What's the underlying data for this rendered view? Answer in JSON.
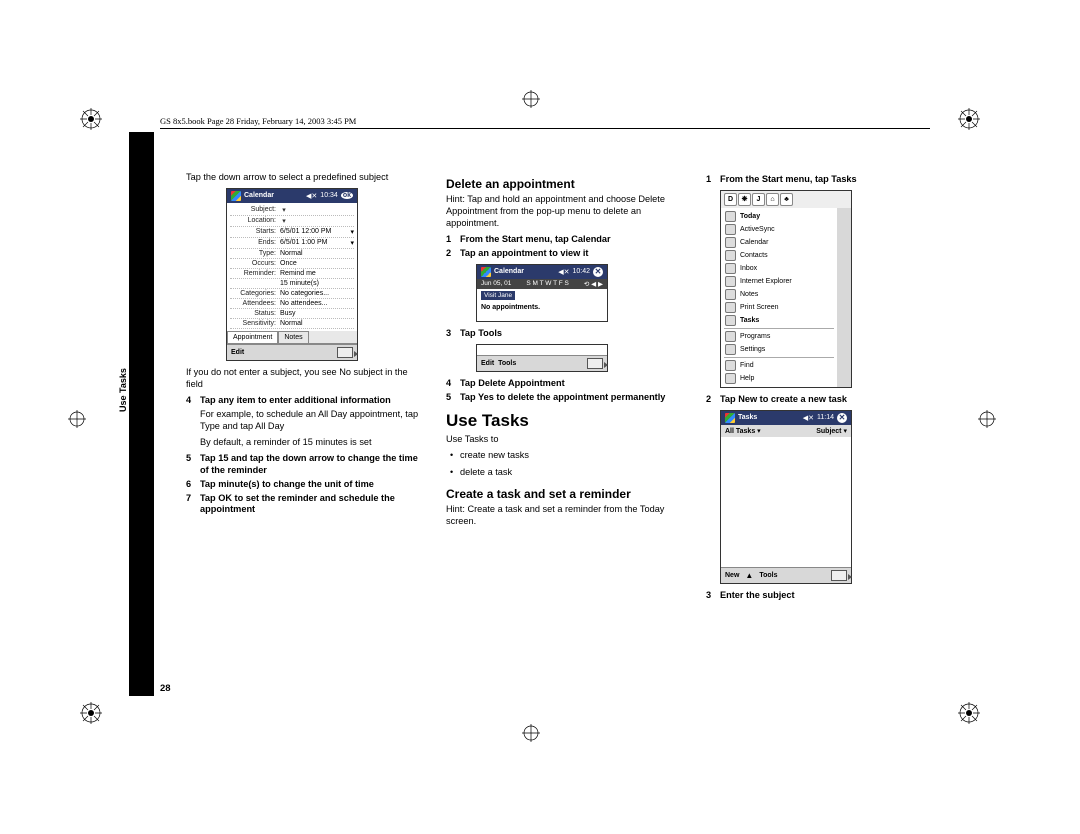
{
  "header": "GS 8x5.book  Page 28  Friday, February 14, 2003  3:45 PM",
  "side_tab": "Use Tasks",
  "page_number": "28",
  "col1": {
    "intro": "Tap the down arrow to select a predefined subject",
    "device": {
      "title": "Calendar",
      "time": "10:34",
      "rows": {
        "subject": {
          "label": "Subject:",
          "value": ""
        },
        "location": {
          "label": "Location:",
          "value": ""
        },
        "starts": {
          "label": "Starts:",
          "value": "6/5/01      12:00 PM"
        },
        "ends": {
          "label": "Ends:",
          "value": "6/5/01       1:00 PM"
        },
        "type": {
          "label": "Type:",
          "value": "Normal"
        },
        "occurs": {
          "label": "Occurs:",
          "value": "Once"
        },
        "reminder": {
          "label": "Reminder:",
          "value": "Remind me"
        },
        "reminder2": {
          "label": "",
          "value": "15   minute(s)"
        },
        "categories": {
          "label": "Categories:",
          "value": "No categories..."
        },
        "attendees": {
          "label": "Attendees:",
          "value": "No attendees..."
        },
        "status": {
          "label": "Status:",
          "value": "Busy"
        },
        "sensitivity": {
          "label": "Sensitivity:",
          "value": "Normal"
        }
      },
      "tabs": {
        "a": "Appointment",
        "b": "Notes"
      },
      "footer": "Edit"
    },
    "no_subject": "If you do not enter a subject, you see No subject in the field",
    "s4": "Tap any item to enter additional information",
    "s4_example": "For example, to schedule an All Day appointment, tap Type and tap All Day",
    "s4_note": "By default, a reminder of 15 minutes is set",
    "s5": "Tap 15 and tap the down arrow to change the time of the reminder",
    "s6": "Tap minute(s) to change the unit of time",
    "s7": "Tap OK to set the reminder and schedule the appointment"
  },
  "col2": {
    "h_delete": "Delete an appointment",
    "delete_hint": "Hint: Tap and hold an appointment and choose Delete Appointment from the pop-up menu to delete an appointment.",
    "s1": "From the Start menu, tap Calendar",
    "s2": "Tap an appointment to view it",
    "cal_device": {
      "title": "Calendar",
      "time": "10:42",
      "date": "Jun 05, 01",
      "days": "S M T W T F S",
      "event": "Visit Jane",
      "empty": "No appointments."
    },
    "s3": "Tap Tools",
    "tools_device": {
      "footer_left": "Edit",
      "footer_right": "Tools"
    },
    "s4": "Tap Delete Appointment",
    "s5": "Tap Yes to delete the appointment permanently",
    "h_use": "Use Tasks",
    "use_intro": "Use Tasks to",
    "b1": "create new tasks",
    "b2": "delete a task",
    "h_create": "Create a task and set a reminder",
    "create_hint": "Hint: Create a task and set a reminder from the Today screen."
  },
  "col3": {
    "s1": "From the Start menu, tap Tasks",
    "start_device": {
      "letters": [
        "D",
        "❋",
        "J",
        "⌂",
        "♣"
      ],
      "items": [
        "Today",
        "ActiveSync",
        "Calendar",
        "Contacts",
        "Inbox",
        "Internet Explorer",
        "Notes",
        "Print Screen",
        "Tasks"
      ],
      "extra": [
        "Programs",
        "Settings",
        "Find",
        "Help"
      ]
    },
    "s2": "Tap New to create a new task",
    "tasks_device": {
      "title": "Tasks",
      "time": "11:14",
      "filter_left": "All Tasks",
      "filter_right": "Subject",
      "footer_new": "New",
      "footer_tools": "Tools"
    },
    "s3": "Enter the subject"
  }
}
